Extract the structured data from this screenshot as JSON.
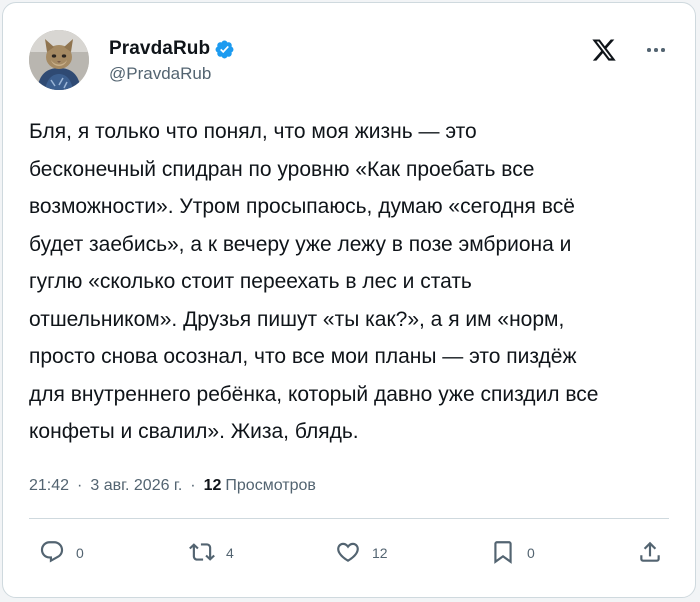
{
  "author": {
    "display_name": "PravdaRub",
    "handle": "@PravdaRub",
    "verified": true
  },
  "tweet": {
    "text": "Бля, я только что понял, что моя жизнь — это\nбесконечный спидран по уровню «Как проебать все\nвозможности». Утром просыпаюсь, думаю «сегодня всё\nбудет заебись», а к вечеру уже лежу в позе эмбриона и\nгуглю «сколько стоит переехать в лес и стать\nотшельником». Друзья пишут «ты как?», а я им «норм,\nпросто снова осознал, что все мои планы — это пиздёж\nдля внутреннего ребёнка, который давно уже спиздил все\nконфеты и свалил». Жиза, блядь."
  },
  "meta": {
    "time": "21:42",
    "separator": "·",
    "date": "3 авг. 2026 г.",
    "views_count": "12",
    "views_label": "Просмотров"
  },
  "actions": {
    "replies": "0",
    "retweets": "4",
    "likes": "12",
    "bookmarks": "0"
  },
  "colors": {
    "text": "#0f1419",
    "secondary": "#536471",
    "verified": "#1d9bf0",
    "border": "#cfd9de"
  },
  "icons": {
    "verified": "verified-badge-icon",
    "brand": "x-logo-icon",
    "more": "more-icon",
    "reply": "reply-icon",
    "retweet": "retweet-icon",
    "like": "heart-icon",
    "bookmark": "bookmark-icon",
    "share": "share-icon"
  }
}
